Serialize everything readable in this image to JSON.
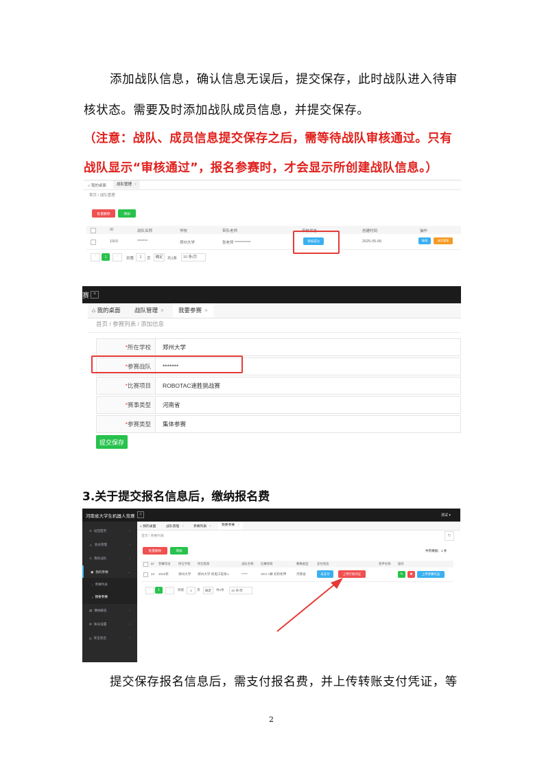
{
  "paragraphs": {
    "p1_line1": "添加战队信息，确认信息无误后，提交保存，此时战队进入待审",
    "p1_line2": "核状态。需要及时添加战队成员信息，并提交保存。",
    "note_line1": "（注意：战队、成员信息提交保存之后，需等待战队审核通过。只有",
    "note_line2": "战队显示“审核通过”，报名参赛时，才会显示所创建战队信息。）",
    "heading3": "3.关于提交报名信息后，缴纳报名费",
    "p2_line1": "提交保存报名信息后，需支付报名费，并上传转账支付凭证，等"
  },
  "shot1": {
    "tabs": [
      "我的桌面",
      "战队管理"
    ],
    "breadcrumb": "首页 / 战队管理",
    "batch_delete": "批量删除",
    "add": "添加",
    "columns": [
      "ID",
      "战队名称",
      "学校",
      "带队老师",
      "审核状态",
      "创建时间",
      "操作"
    ],
    "row": {
      "id": "1910",
      "name": "*******",
      "school": "郑州大学",
      "teacher": "张老师 ***********",
      "status": "审核成功",
      "date": "2025-05-06",
      "edit": "修改",
      "members": "成员管理"
    },
    "pager": {
      "page": "1",
      "goto": "到第",
      "page_input": "1",
      "page_unit": "页",
      "confirm": "确定",
      "total": "共1条",
      "per_page": "10 条/页"
    }
  },
  "shot2": {
    "brand_tail": "赛",
    "tabs": [
      "我的桌面",
      "战队管理",
      "我要参赛"
    ],
    "breadcrumb": "首页 / 参赛列表 / 添加信息",
    "fields": [
      {
        "label": "所在学校",
        "value": "郑州大学"
      },
      {
        "label": "参赛战队",
        "value": "*******"
      },
      {
        "label": "比赛项目",
        "value": "ROBOTAC速胜挑战赛"
      },
      {
        "label": "赛事类型",
        "value": "河南省"
      },
      {
        "label": "参赛类型",
        "value": "集体参赛"
      }
    ],
    "submit": "提交保存"
  },
  "shot3": {
    "title": "河南省大学生机器人竞赛",
    "user": "测试",
    "tabs": [
      "我的桌面",
      "战队管理",
      "参赛列表",
      "我要参赛"
    ],
    "breadcrumb": "首页 / 参赛列表",
    "sidebar": [
      "返回首页",
      "会员管理",
      "我的战队",
      "我的参赛",
      "参赛列表",
      "我要参赛",
      "缴纳报名",
      "账号设置",
      "安全退出"
    ],
    "batch_delete": "批量删除",
    "add": "添加",
    "total_data": "共有数据：1 条",
    "columns": [
      "ID",
      "参赛年份",
      "所在学校",
      "所在院系",
      "战队名称",
      "比赛项目",
      "赛事类型",
      "支付状态",
      "",
      "装甲名称",
      "操作"
    ],
    "row": {
      "id": "23",
      "year": "2023年",
      "school": "郑州大学",
      "dept": "郑州大学-机电工程系1",
      "team": "*****",
      "project": "VEX A赛 初阶机甲",
      "type": "河南省",
      "paid": "未支付",
      "upload": "上传打款凭证",
      "upload_work": "上传参赛作品"
    },
    "pager": {
      "goto": "到第",
      "page_input": "1",
      "page_unit": "页",
      "confirm": "确定",
      "total": "共1条",
      "per_page": "10 条/页",
      "page": "1"
    }
  },
  "page_number": "2",
  "colors": {
    "red_note": "#e0201c",
    "green_btn": "#27c24c",
    "red_btn": "#f05050",
    "blue_btn": "#3ab0f0",
    "orange_btn": "#f59a23",
    "highlight": "#e53935"
  }
}
